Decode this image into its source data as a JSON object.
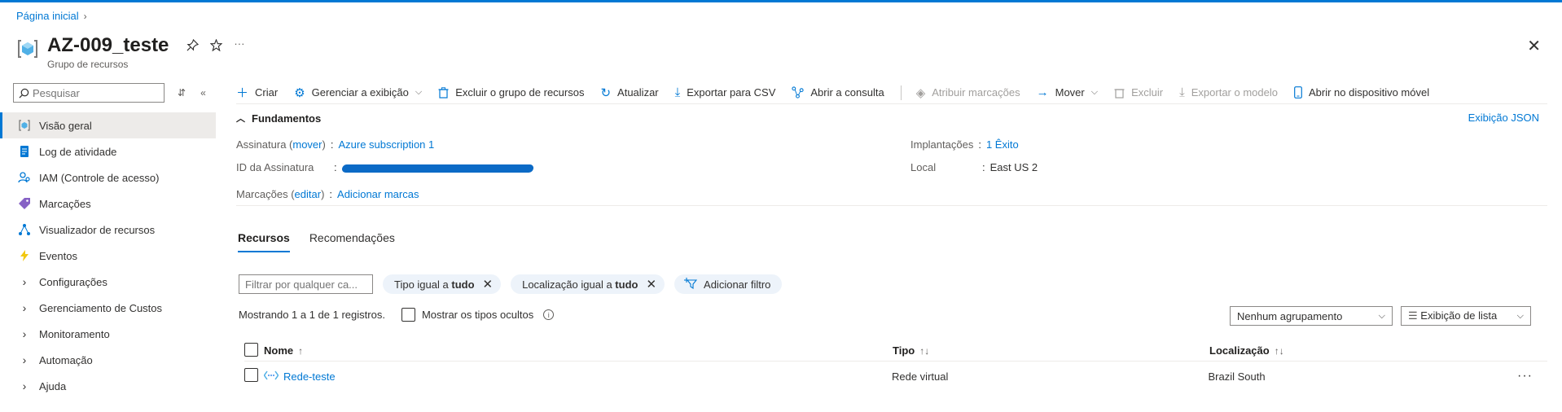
{
  "breadcrumb": {
    "home": "Página inicial"
  },
  "header": {
    "title": "AZ-009_teste",
    "subtitle": "Grupo de recursos",
    "more": "···"
  },
  "sidebar": {
    "search_placeholder": "Pesquisar",
    "items": [
      {
        "label": "Visão geral",
        "icon": "resource-group-icon"
      },
      {
        "label": "Log de atividade",
        "icon": "activity-log-icon"
      },
      {
        "label": "IAM (Controle de acesso)",
        "icon": "iam-icon"
      },
      {
        "label": "Marcações",
        "icon": "tag-icon"
      },
      {
        "label": "Visualizador de recursos",
        "icon": "resource-visualizer-icon"
      },
      {
        "label": "Eventos",
        "icon": "lightning-icon"
      },
      {
        "label": "Configurações",
        "icon": "chevron-right-icon"
      },
      {
        "label": "Gerenciamento de Custos",
        "icon": "chevron-right-icon"
      },
      {
        "label": "Monitoramento",
        "icon": "chevron-right-icon"
      },
      {
        "label": "Automação",
        "icon": "chevron-right-icon"
      },
      {
        "label": "Ajuda",
        "icon": "chevron-right-icon"
      }
    ]
  },
  "toolbar": {
    "create": "Criar",
    "manage_view": "Gerenciar a exibição",
    "delete_rg": "Excluir o grupo de recursos",
    "refresh": "Atualizar",
    "export_csv": "Exportar para CSV",
    "open_query": "Abrir a consulta",
    "assign_tags": "Atribuir marcações",
    "move": "Mover",
    "delete": "Excluir",
    "export_template": "Exportar o modelo",
    "open_mobile": "Abrir no dispositivo móvel"
  },
  "essentials": {
    "heading": "Fundamentos",
    "json_view": "Exibição JSON",
    "subscription_label": "Assinatura",
    "subscription_action": "mover",
    "subscription_value": "Azure subscription 1",
    "subscription_id_label": "ID da Assinatura",
    "tags_label": "Marcações",
    "tags_action": "editar",
    "tags_value": "Adicionar marcas",
    "deployments_label": "Implantações",
    "deployments_value": "1 Êxito",
    "location_label": "Local",
    "location_value": "East US 2",
    "separator": ":"
  },
  "tabs": [
    "Recursos",
    "Recomendações"
  ],
  "filters": {
    "placeholder": "Filtrar por qualquer ca...",
    "type_filter_prefix": "Tipo igual a",
    "type_filter_value": "tudo",
    "location_filter_prefix": "Localização igual a",
    "location_filter_value": "tudo",
    "add_filter": "Adicionar filtro"
  },
  "records": {
    "count_text": "Mostrando 1 a 1 de 1 registros.",
    "show_hidden": "Mostrar os tipos ocultos"
  },
  "grouping": {
    "selected": "Nenhum agrupamento"
  },
  "view_mode": {
    "selected": "Exibição de lista"
  },
  "table": {
    "columns": {
      "name": "Nome",
      "type": "Tipo",
      "location": "Localização"
    },
    "rows": [
      {
        "name": "Rede-teste",
        "type": "Rede virtual",
        "location": "Brazil South"
      }
    ]
  },
  "colors": {
    "accent": "#0078d4",
    "pill_bg": "#edf3fa",
    "active_nav_bg": "#edebe9"
  }
}
